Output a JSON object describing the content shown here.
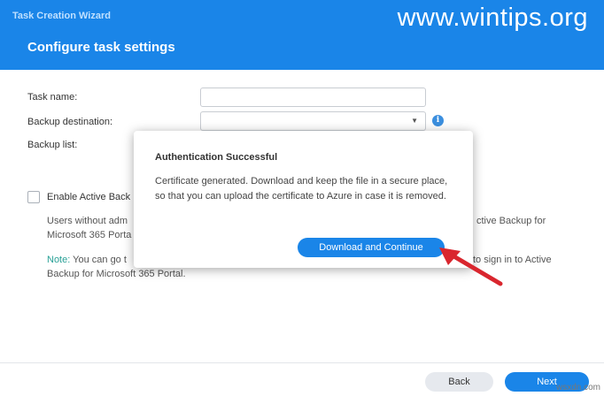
{
  "window": {
    "title": "Task Creation Wizard",
    "watermark": "www.wintips.org"
  },
  "page": {
    "title": "Configure task settings"
  },
  "form": {
    "task_name_label": "Task name:",
    "task_name_value": "",
    "backup_destination_label": "Backup destination:",
    "backup_destination_value": "",
    "backup_list_label": "Backup list:",
    "info_icon": "info-icon"
  },
  "options": {
    "enable_label": "Enable Active Back",
    "enable_checked": false,
    "users_line1_left": "Users without adm",
    "users_line1_right": "ctive Backup for",
    "users_line2": "Microsoft 365 Porta",
    "note_prefix": "Note:",
    "note_line1_left": "You can go t",
    "note_line1_right": "to sign in to Active",
    "note_line2": "Backup for Microsoft 365 Portal."
  },
  "dialog": {
    "title": "Authentication Successful",
    "body": "Certificate generated. Download and keep the file in a secure place, so that you can upload the certificate to Azure in case it is removed.",
    "button": "Download and Continue"
  },
  "footer": {
    "back_label": "Back",
    "next_label": "Next",
    "corner_mark": "wsxdn.com"
  },
  "colors": {
    "accent": "#1a85e8",
    "arrow": "#d9262e",
    "note": "#2aa197"
  }
}
